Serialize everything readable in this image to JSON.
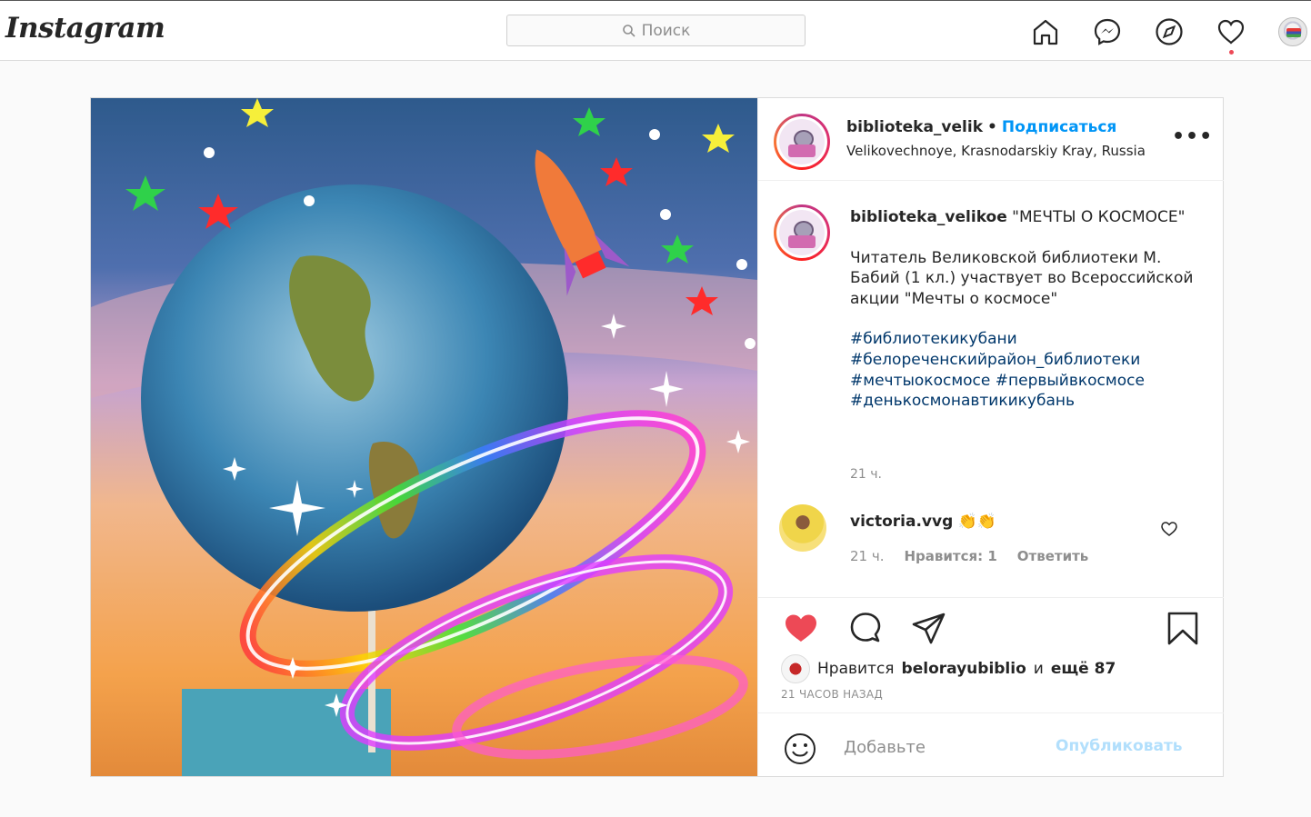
{
  "app": {
    "logo": "Instagram"
  },
  "search": {
    "placeholder": "Поиск",
    "icon": "search-icon"
  },
  "nav": {
    "icons": [
      "home-icon",
      "messenger-icon",
      "explore-icon",
      "heart-icon",
      "avatar"
    ],
    "notification_color": "#ed4956"
  },
  "post": {
    "username": "biblioteka_velik",
    "separator": "•",
    "follow_label": "Подписаться",
    "location": "Velikovechnoye, Krasnodarskiy Kray, Russia",
    "more_label": "•••",
    "caption": {
      "username": "biblioteka_velikoe",
      "title": "\"МЕЧТЫ О КОСМОСЕ\"",
      "body": "Читатель Великовской библиотеки М. Бабий (1 кл.) участвует во Всероссийской акции \"Мечты о космосе\"",
      "hashtags": [
        "#библиотекикубани",
        "#белореченскийрайон_библиотеки",
        "#мечтыокосмосе #первыйвкосмосе",
        "#денькосмонавтикикубань"
      ],
      "time": "21 ч."
    },
    "comment": {
      "username": "victoria.vvg",
      "text": "👏👏",
      "time": "21 ч.",
      "likes_label": "Нравится: 1",
      "reply_label": "Ответить"
    },
    "likes": {
      "prefix": "Нравится",
      "user": "belorayubiblio",
      "connector": "и",
      "others": "ещё 87"
    },
    "posted_time": "21 ЧАСОВ НАЗАД",
    "comment_input": {
      "placeholder": "Добавьте",
      "publish_label": "Опубликовать"
    },
    "colors": {
      "like": "#ed4956",
      "link": "#0095f6",
      "hashtag": "#00376b",
      "publish_disabled": "#b2dffc"
    }
  }
}
